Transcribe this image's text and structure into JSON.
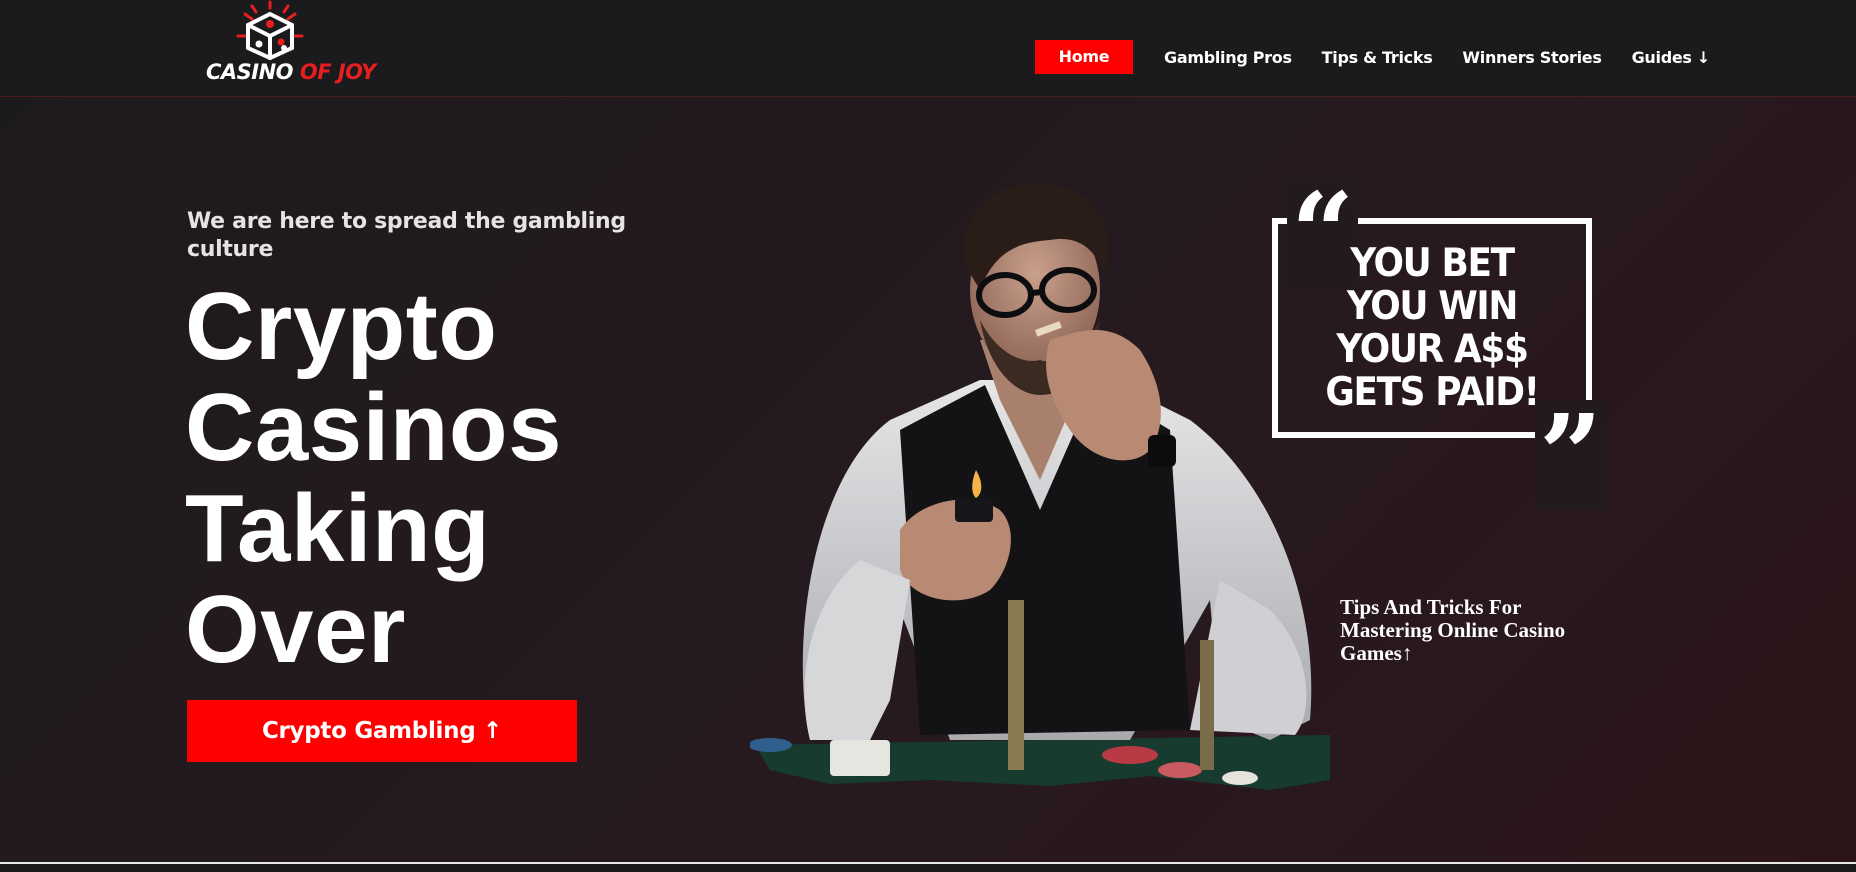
{
  "logo": {
    "word1": "CASINO",
    "word2": "OF JOY"
  },
  "nav": {
    "home": "Home",
    "items": [
      "Gambling Pros",
      "Tips & Tricks",
      "Winners Stories",
      "Guides ↓"
    ]
  },
  "hero": {
    "subtitle": "We are here to spread the gambling culture",
    "headline": [
      "Crypto",
      "Casinos",
      "Taking",
      "Over"
    ],
    "cta": "Crypto Gambling ↑"
  },
  "quote": {
    "lines": [
      "YOU BET",
      "YOU WIN",
      "YOUR A$$",
      "GETS PAID!"
    ]
  },
  "tips": {
    "line1": "Tips And Tricks For",
    "line2": "Mastering Online Casino",
    "line3": "Games↑"
  },
  "colors": {
    "accent": "#fe0000",
    "background": "#1e1a1d",
    "text": "#ffffff"
  },
  "icons": {
    "logo": "dice-logo-icon",
    "photo": "man-smoking-cigar-image"
  }
}
